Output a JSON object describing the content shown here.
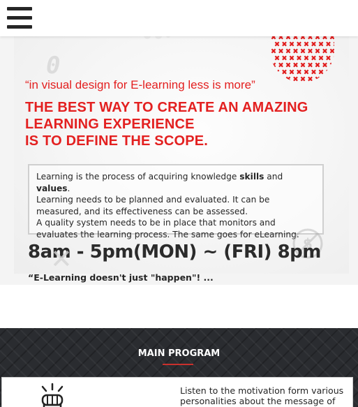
{
  "nav": {
    "menu_icon": "hamburger-menu-icon"
  },
  "hero": {
    "background_number": "0",
    "quote": "“in visual design for E-learning less is more”",
    "headline": [
      "THE BEST WAY TO CREATE AN AMAZING",
      "LEARNING EXPERIENCE",
      "IS TO DEFINE THE SCOPE."
    ],
    "info": {
      "l1_pre": "Learning is the process of acquiring knowledge ",
      "l1_skills": "skills",
      "l1_mid": " and ",
      "l1_values": "values",
      "l1_end": ".",
      "l2": "Learning needs to be planned and evaluated. It can be measured, and its effectiveness can be assessed.",
      "l3": "A quality system needs to be in place that monitors and evaluates the learning process. The same goes for eLearning."
    },
    "schedule": "8am - 5pm(MON) ~ (FRI) 8pm",
    "tagline": "“E-Learning doesn't just \"happen\"! ..."
  },
  "program": {
    "title": "MAIN PROGRAM",
    "card_text": "Listen to the motivation form various personalities about the message of"
  },
  "colors": {
    "accent_red": "#e32020",
    "underline_red": "#c9302c",
    "dark_section": "#2a2c30",
    "text_dark": "#262626"
  },
  "icons": {
    "menu": "hamburger-menu-icon",
    "pattern": "red-black-x-pattern-icon",
    "dollar": "no-dollar-icon",
    "program": "raised-fist-icon"
  }
}
